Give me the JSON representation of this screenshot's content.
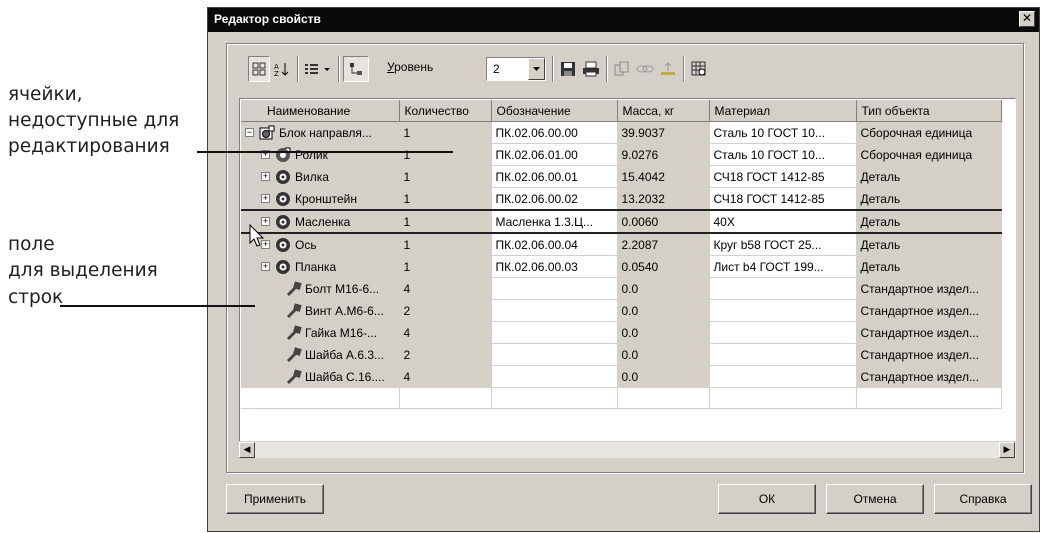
{
  "annotations": {
    "cells_label": [
      "ячейки,",
      "недоступные для",
      "редактирования"
    ],
    "rows_label": [
      "поле",
      "для выделения",
      "строк"
    ]
  },
  "window": {
    "title": "Редактор свойств",
    "close_glyph": "✕"
  },
  "toolbar": {
    "level_label_first": "У",
    "level_label_rest": "ровень",
    "level_value": "2",
    "icons": [
      "grid-icon",
      "sort-az-icon",
      "list-view-icon",
      "tree-view-icon",
      "save-icon",
      "print-icon",
      "copy-icon",
      "link-icon",
      "export-icon",
      "settings-grid-icon"
    ]
  },
  "table": {
    "columns": [
      "Наименование",
      "Количество",
      "Обозначение",
      "Масса, кг",
      "Материал",
      "Тип объекта"
    ],
    "rows": [
      {
        "name": "Блок направля...",
        "qty": "1",
        "code": "ПК.02.06.00.00",
        "mass": "39.9037",
        "material": "Сталь 10  ГОСТ 10...",
        "type": "Сборочная единица",
        "kind": "assembly-root"
      },
      {
        "name": "Ролик",
        "qty": "1",
        "code": "ПК.02.06.01.00",
        "mass": "9.0276",
        "material": "Сталь 10  ГОСТ 10...",
        "type": "Сборочная единица",
        "kind": "assembly"
      },
      {
        "name": "Вилка",
        "qty": "1",
        "code": "ПК.02.06.00.01",
        "mass": "15.4042",
        "material": "СЧ18 ГОСТ 1412-85",
        "type": "Деталь",
        "kind": "part"
      },
      {
        "name": "Кронштейн",
        "qty": "1",
        "code": "ПК.02.06.00.02",
        "mass": "13.2032",
        "material": "СЧ18 ГОСТ 1412-85",
        "type": "Деталь",
        "kind": "part"
      },
      {
        "name": "Масленка",
        "qty": "1",
        "code": "Масленка  1.3.Ц...",
        "mass": "0.0060",
        "material": "40Х",
        "type": "Деталь",
        "kind": "part"
      },
      {
        "name": "Ось",
        "qty": "1",
        "code": "ПК.02.06.00.04",
        "mass": "2.2087",
        "material": "Круг  b58  ГОСТ 25...",
        "type": "Деталь",
        "kind": "part"
      },
      {
        "name": "Планка",
        "qty": "1",
        "code": "ПК.02.06.00.03",
        "mass": "0.0540",
        "material": "Лист  b4 ГОСТ 199...",
        "type": "Деталь",
        "kind": "part"
      },
      {
        "name": "Болт М16-6...",
        "qty": "4",
        "code": "",
        "mass": "0.0",
        "material": "",
        "type": "Стандартное издел...",
        "kind": "standard"
      },
      {
        "name": "Винт А.М6-6...",
        "qty": "2",
        "code": "",
        "mass": "0.0",
        "material": "",
        "type": "Стандартное издел...",
        "kind": "standard"
      },
      {
        "name": "Гайка  М16-...",
        "qty": "4",
        "code": "",
        "mass": "0.0",
        "material": "",
        "type": "Стандартное издел...",
        "kind": "standard"
      },
      {
        "name": "Шайба А.6.3...",
        "qty": "2",
        "code": "",
        "mass": "0.0",
        "material": "",
        "type": "Стандартное издел...",
        "kind": "standard"
      },
      {
        "name": "Шайба С.16....",
        "qty": "4",
        "code": "",
        "mass": "0.0",
        "material": "",
        "type": "Стандартное издел...",
        "kind": "standard"
      }
    ],
    "expander_plus": "+",
    "expander_minus": "−"
  },
  "scrollbar": {
    "left_glyph": "◀",
    "right_glyph": "▶"
  },
  "buttons": {
    "apply": "Применить",
    "ok": "ОК",
    "cancel": "Отмена",
    "help": "Справка"
  }
}
